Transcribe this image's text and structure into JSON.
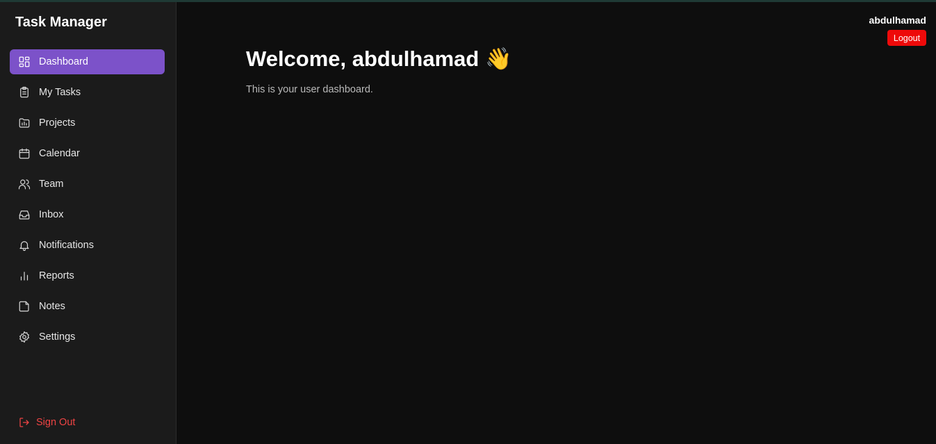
{
  "app": {
    "title": "Task Manager"
  },
  "sidebar": {
    "items": [
      {
        "label": "Dashboard",
        "icon": "dashboard-icon",
        "active": true
      },
      {
        "label": "My Tasks",
        "icon": "clipboard-icon"
      },
      {
        "label": "Projects",
        "icon": "folder-icon"
      },
      {
        "label": "Calendar",
        "icon": "calendar-icon"
      },
      {
        "label": "Team",
        "icon": "users-icon"
      },
      {
        "label": "Inbox",
        "icon": "inbox-icon"
      },
      {
        "label": "Notifications",
        "icon": "bell-icon"
      },
      {
        "label": "Reports",
        "icon": "bar-chart-icon"
      },
      {
        "label": "Notes",
        "icon": "note-icon"
      },
      {
        "label": "Settings",
        "icon": "gear-icon"
      }
    ],
    "sign_out_label": "Sign Out"
  },
  "header": {
    "username": "abdulhamad",
    "logout_label": "Logout"
  },
  "main": {
    "welcome": "Welcome, abdulhamad 👋",
    "subtitle": "This is your user dashboard."
  },
  "colors": {
    "accent": "#7c52c9",
    "danger": "#ee0a0a",
    "sidebar_bg": "#1b1b1b",
    "main_bg": "#0e0e0e"
  }
}
